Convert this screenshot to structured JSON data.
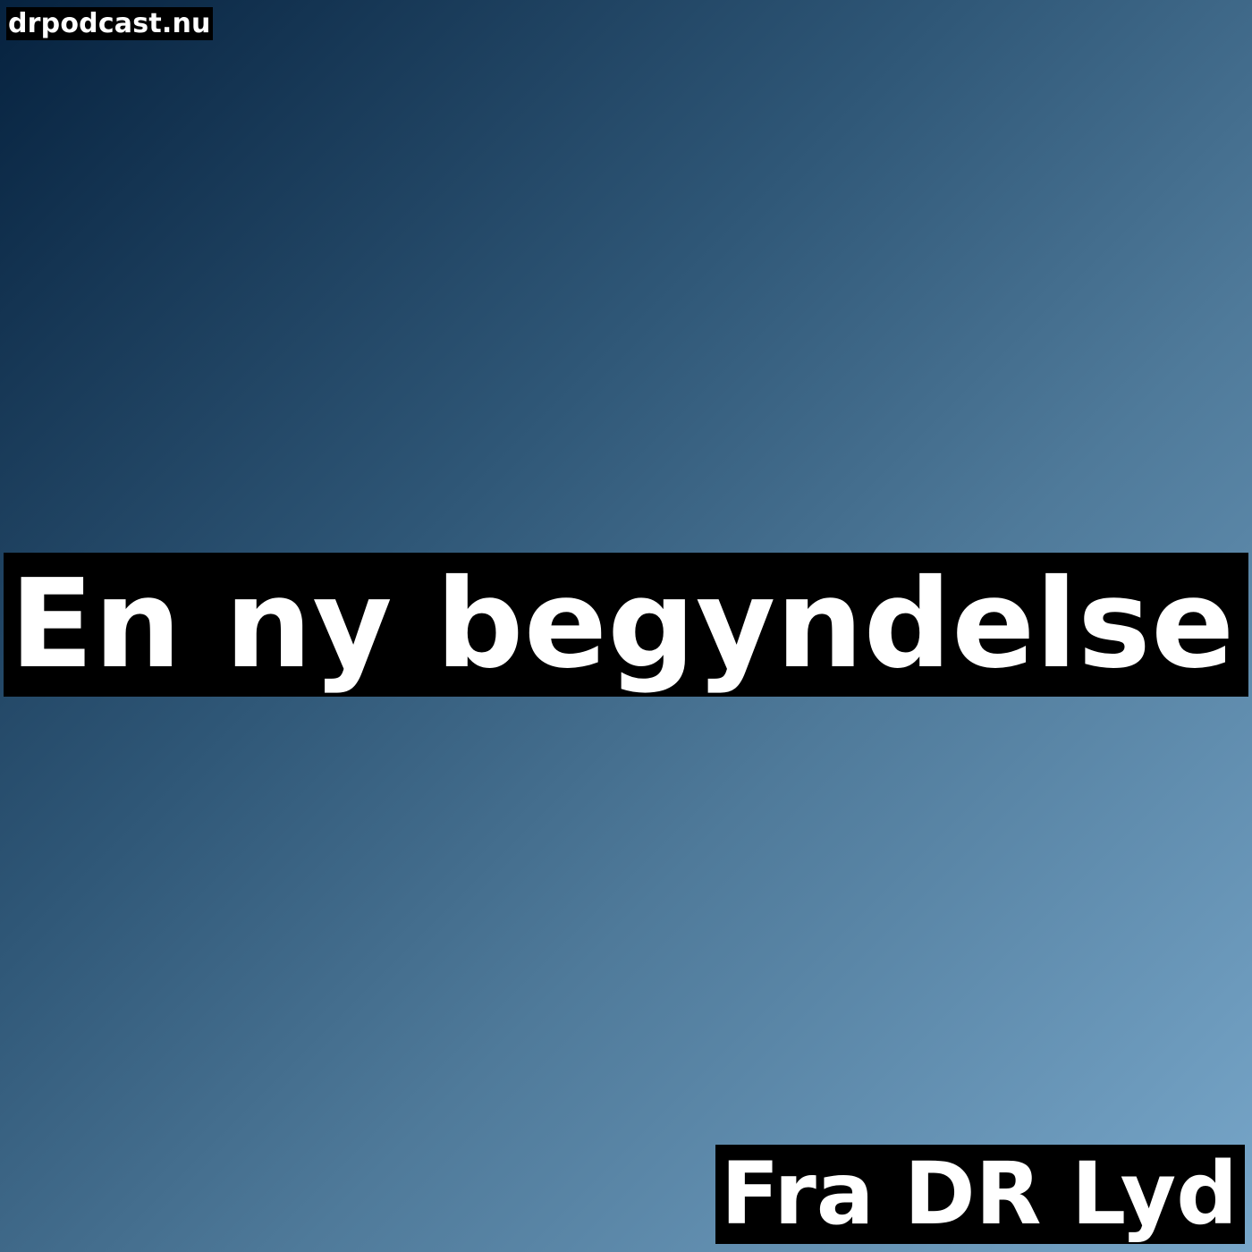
{
  "cover": {
    "site": "drpodcast.nu",
    "title": "En ny begyndelse",
    "source": "Fra DR Lyd"
  },
  "colors": {
    "gradient_top_left": "#06223f",
    "gradient_bottom_right": "#78a7ca",
    "label_background": "#000000",
    "label_text": "#ffffff"
  }
}
